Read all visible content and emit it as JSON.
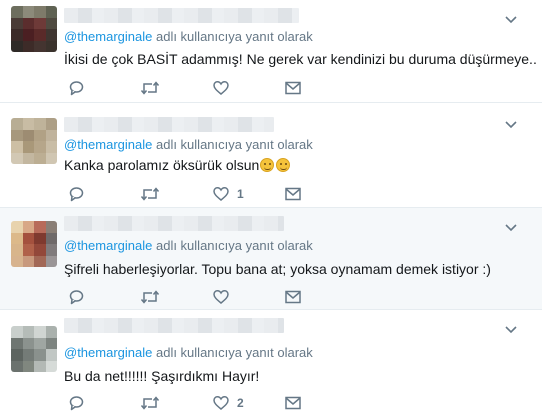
{
  "tweets": [
    {
      "reply_handle": "@themarginale",
      "reply_suffix": "adlı kullanıcıya yanıt olarak",
      "text": "İkisi de çok BASİT adammış! Ne gerek var kendinizi bu duruma düşürmeye..",
      "reply_count": "",
      "retweet_count": "",
      "like_count": "",
      "highlighted": false
    },
    {
      "reply_handle": "@themarginale",
      "reply_suffix": "adlı kullanıcıya yanıt olarak",
      "text": "Kanka parolamız öksürük olsun",
      "emojis": [
        "winking-face-emoji",
        "smiling-face-emoji"
      ],
      "reply_count": "",
      "retweet_count": "",
      "like_count": "1",
      "highlighted": false
    },
    {
      "reply_handle": "@themarginale",
      "reply_suffix": "adlı kullanıcıya yanıt olarak",
      "text": "Şifreli haberleşiyorlar. Topu bana at; yoksa oynamam demek istiyor :)",
      "reply_count": "",
      "retweet_count": "",
      "like_count": "",
      "highlighted": true
    },
    {
      "reply_handle": "@themarginale",
      "reply_suffix": "adlı kullanıcıya yanıt olarak",
      "text": "Bu da net!!!!!! Şaşırdıkmı Hayır!",
      "reply_count": "",
      "retweet_count": "",
      "like_count": "2",
      "highlighted": false
    }
  ],
  "icons": {
    "reply": "reply-icon",
    "retweet": "retweet-icon",
    "like": "heart-icon",
    "dm": "envelope-icon",
    "menu": "chevron-down-icon"
  },
  "colors": {
    "link": "#1b95e0",
    "muted": "#657786",
    "text": "#14171a",
    "divider": "#e6ecf0",
    "highlight_bg": "#f5f8fa"
  }
}
